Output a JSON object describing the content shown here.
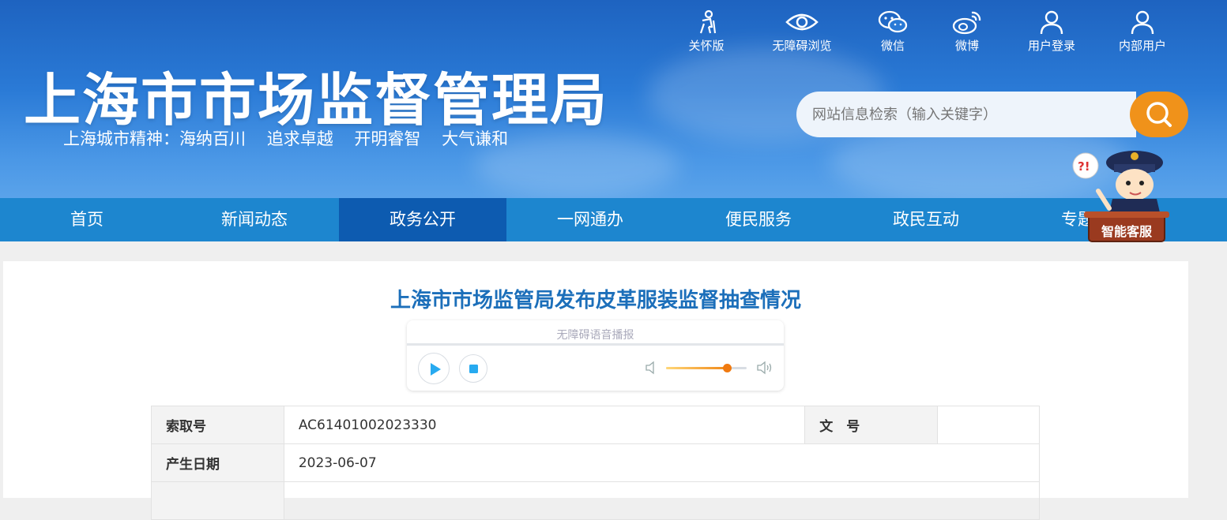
{
  "header": {
    "site_title": "上海市市场监督管理局",
    "slogan": "上海城市精神：海纳百川    追求卓越    开明睿智    大气谦和",
    "top_links": [
      {
        "label": "关怀版",
        "icon": "elder-care-icon"
      },
      {
        "label": "无障碍浏览",
        "icon": "eye-icon"
      },
      {
        "label": "微信",
        "icon": "wechat-icon"
      },
      {
        "label": "微博",
        "icon": "weibo-icon"
      },
      {
        "label": "用户登录",
        "icon": "user-icon"
      },
      {
        "label": "内部用户",
        "icon": "user-icon"
      }
    ],
    "search": {
      "placeholder": "网站信息检索（输入关键字）",
      "button_icon": "search-icon"
    }
  },
  "nav": {
    "items": [
      "首页",
      "新闻动态",
      "政务公开",
      "一网通办",
      "便民服务",
      "政民互动",
      "专题"
    ],
    "active": "政务公开"
  },
  "assistant": {
    "label": "智能客服"
  },
  "article": {
    "title": "上海市市场监管局发布皮革服装监督抽查情况",
    "player": {
      "label": "无障碍语音播报",
      "volume_level": 0.75
    }
  },
  "meta_table": {
    "index_label": "索取号",
    "index_value": "AC61401002023330",
    "doc_label": "文　号",
    "doc_value": "",
    "date_label": "产生日期",
    "date_value": "2023-06-07"
  },
  "colors": {
    "header_blue": "#2a7ad6",
    "nav_blue": "#1d86cf",
    "nav_active": "#0d5bb0",
    "search_orange": "#f0921a",
    "title_blue": "#1c6fba"
  }
}
